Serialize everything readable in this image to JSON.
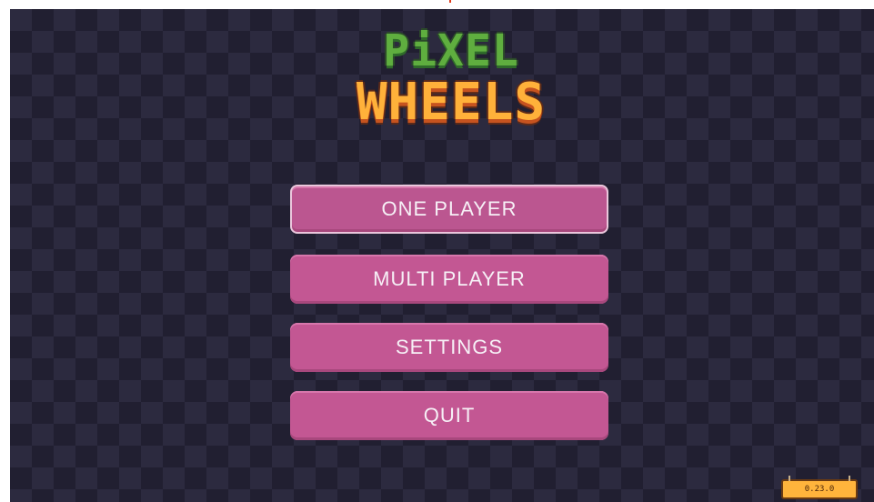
{
  "logo": {
    "line1": "PiXEL",
    "line2": "WHEELS"
  },
  "menu": {
    "items": [
      {
        "label": "ONE PLAYER",
        "selected": true
      },
      {
        "label": "MULTI PLAYER",
        "selected": false
      },
      {
        "label": "SETTINGS",
        "selected": false
      },
      {
        "label": "QUIT",
        "selected": false
      }
    ]
  },
  "version": "0.23.0",
  "colors": {
    "background_light": "#2c2a3f",
    "background_dark": "#211f31",
    "button": "#c35793",
    "button_text": "#f6f0f6",
    "logo_green": "#5fae3f",
    "logo_orange": "#ffb13a",
    "version_badge": "#ffb43c"
  }
}
